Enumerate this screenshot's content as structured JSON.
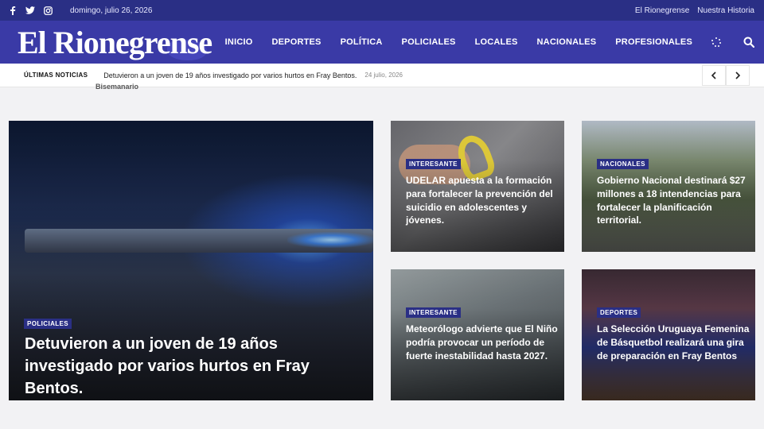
{
  "topbar": {
    "social": [
      {
        "icon": "facebook-icon",
        "glyph": "f"
      },
      {
        "icon": "twitter-icon",
        "glyph": "🐦"
      },
      {
        "icon": "instagram-icon",
        "glyph": "◎"
      }
    ],
    "date": "domingo, julio 26, 2026",
    "links": [
      "El Rionegrense",
      "Nuestra Historia"
    ]
  },
  "header": {
    "logo": "El Rionegrense",
    "subtitle": "Bisemanario",
    "nav": [
      "INICIO",
      "DEPORTES",
      "POLÍTICA",
      "POLICIALES",
      "LOCALES",
      "NACIONALES",
      "PROFESIONALES"
    ]
  },
  "ticker": {
    "label": "ÚLTIMAS NOTICIAS",
    "text": "Detuvieron a un joven de 19 años investigado por varios hurtos en Fray Bentos.",
    "date": "24 julio, 2026"
  },
  "articles": {
    "hero": {
      "tag": "POLICIALES",
      "title": "Detuvieron a un joven de 19 años investigado por varios hurtos en Fray Bentos."
    },
    "a1": {
      "tag": "INTERESANTE",
      "title": "UDELAR apuesta a la formación para fortalecer la prevención del suicidio en adolescentes y jóvenes."
    },
    "a2": {
      "tag": "NACIONALES",
      "title": "Gobierno Nacional destinará $27 millones a 18 intendencias para fortalecer la planificación territorial."
    },
    "a3": {
      "tag": "INTERESANTE",
      "title": "Meteorólogo advierte que El Niño podría provocar un período de fuerte inestabilidad hasta 2027."
    },
    "a4": {
      "tag": "DEPORTES",
      "title": "La Selección Uruguaya Femenina de Básquetbol realizará una gira de preparación en Fray Bentos"
    }
  },
  "colors": {
    "brand": "#2a2f85",
    "header": "#3a3aa6"
  }
}
